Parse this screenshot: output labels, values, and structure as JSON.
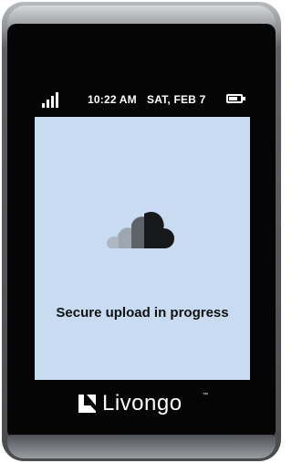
{
  "status_bar": {
    "time": "10:22 AM",
    "date": "SAT, FEB 7",
    "signal_bars": 4,
    "battery_level": 0.75
  },
  "screen": {
    "message": "Secure upload in progress",
    "icon": "cloud-upload-icon",
    "background_color": "#c8dcf1"
  },
  "brand": {
    "name": "Livongo",
    "trademark": "™"
  }
}
